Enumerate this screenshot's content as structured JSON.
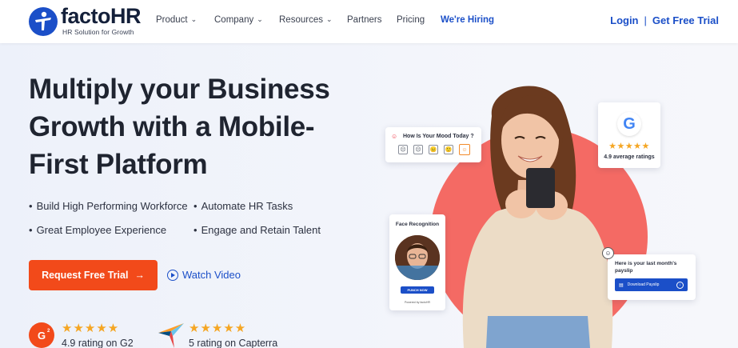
{
  "brand": {
    "name": "factoHR",
    "tagline": "HR Solution for Growth",
    "accent_color": "#1b4fc8",
    "cta_color": "#f24a1a"
  },
  "nav": {
    "items": [
      {
        "label": "Product",
        "has_dropdown": true
      },
      {
        "label": "Company",
        "has_dropdown": true
      },
      {
        "label": "Resources",
        "has_dropdown": true
      },
      {
        "label": "Partners",
        "has_dropdown": false
      },
      {
        "label": "Pricing",
        "has_dropdown": false
      },
      {
        "label": "We're Hiring",
        "has_dropdown": false
      }
    ],
    "login": "Login",
    "separator": "|",
    "trial": "Get Free Trial"
  },
  "hero": {
    "title": "Multiply your Business Growth with a Mobile-First Platform",
    "bullets": [
      "Build High Performing Workforce",
      "Automate HR Tasks",
      "Great Employee Experience",
      "Engage and Retain Talent"
    ],
    "cta_label": "Request Free Trial",
    "cta_arrow": "→",
    "watch_label": "Watch Video"
  },
  "ratings": [
    {
      "source_icon": "g2-logo-icon",
      "badge": "G2",
      "stars": "★★★★★",
      "text": "4.9 rating on G2"
    },
    {
      "source_icon": "capterra-logo-icon",
      "stars": "★★★★★",
      "text": "5 rating on Capterra"
    }
  ],
  "cards": {
    "mood": {
      "title": "How Is Your Mood Today ?",
      "faces": [
        "☹",
        "☹",
        "😐",
        "🙂",
        "☺"
      ]
    },
    "google": {
      "letter": "G",
      "stars": "★★★★★",
      "text": "4.9 average ratings"
    },
    "face": {
      "title": "Face Recognition",
      "button": "PUNCH NOW",
      "footer": "Powered by factoHR"
    },
    "payslip": {
      "title": "Here is your last month's payslip",
      "button": "Download Payslip"
    }
  }
}
